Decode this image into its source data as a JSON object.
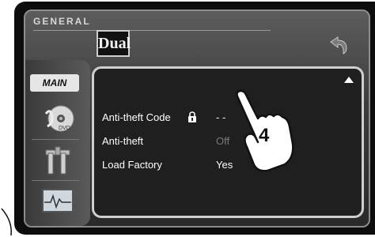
{
  "header": {
    "section_label": "GENERAL",
    "logo_text": "Dual"
  },
  "sidebar": {
    "main_tab_label": "MAIN"
  },
  "panel": {
    "rows": [
      {
        "label": "Anti-theft Code",
        "value": "- -"
      },
      {
        "label": "Anti-theft",
        "value": "Off"
      },
      {
        "label": "Load Factory",
        "value": "Yes"
      }
    ]
  },
  "callout": {
    "step_number": "4"
  },
  "icons": {
    "back": "back-arrow-icon",
    "lock": "lock-icon",
    "scroll_up": "scroll-up-arrow-icon",
    "dvd": "dvd-disc-icon",
    "tools": "tools-icon",
    "signal": "signal-monitor-icon"
  },
  "colors": {
    "background": "#3c3c3c",
    "panel": "#1f1f1f",
    "text": "#ffffff",
    "dim_value": "#7a7a7a"
  }
}
